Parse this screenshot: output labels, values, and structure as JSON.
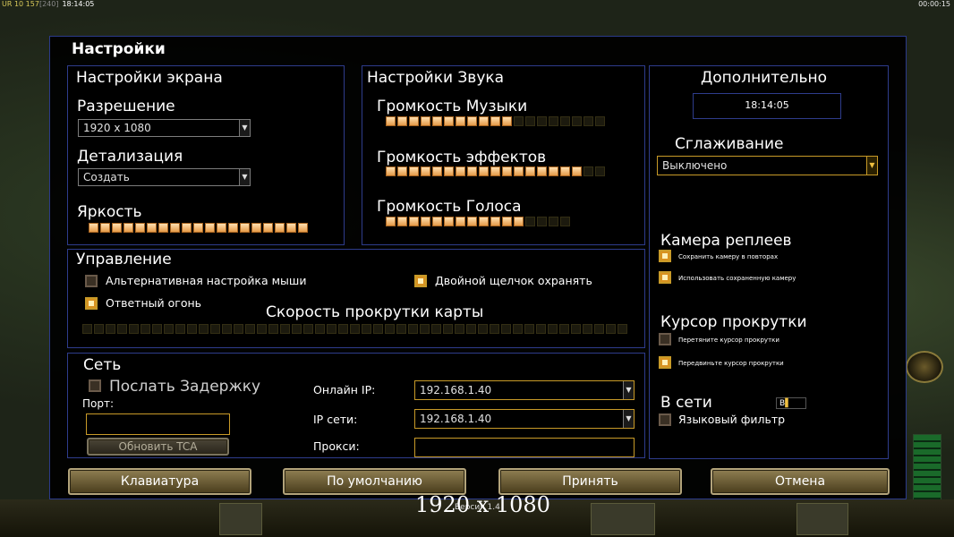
{
  "hud": {
    "resource_prefix": "UR 10 157",
    "resource_dim": "[240]",
    "clock_left": "18:14:05",
    "clock_right": "00:00:15"
  },
  "dialog": {
    "title": "Настройки"
  },
  "screen": {
    "title": "Настройки экрана",
    "resolution_label": "Разрешение",
    "resolution_value": "1920 x 1080",
    "detail_label": "Детализация",
    "detail_value": "Создать",
    "brightness_label": "Яркость",
    "brightness_level": 1.0
  },
  "sound": {
    "title": "Настройки Звука",
    "music_label": "Громкость Музыки",
    "music_level": 0.58,
    "effects_label": "Громкость эффектов",
    "effects_level": 0.87,
    "voice_label": "Громкость Голоса",
    "voice_level": 0.75
  },
  "extra": {
    "title": "Дополнительно",
    "clock": "18:14:05",
    "antialias_label": "Сглаживание",
    "antialias_value": "Выключено",
    "replay_camera_title": "Камера реплеев",
    "replay_save_camera": "Сохранить камеру в повторах",
    "replay_use_saved_camera": "Использовать сохраненную камеру",
    "scroll_cursor_title": "Курсор прокрутки",
    "scroll_cursor_opt1": "Перетяните курсор прокрутки",
    "scroll_cursor_opt2": "Передвиньте курсор прокрутки",
    "online_title": "В сети",
    "lang_badge": "В",
    "lang_filter_label": "Языковый фильтр"
  },
  "controls": {
    "title": "Управление",
    "alt_mouse_label": "Альтернативная настройка мыши",
    "double_click_label": "Двойной щелчок охранять",
    "return_fire_label": "Ответный огонь",
    "scroll_speed_label": "Скорость прокрутки карты",
    "scroll_speed_level": 0.0
  },
  "network": {
    "title": "Сеть",
    "send_delay_label": "Послать Задержку",
    "port_label": "Порт:",
    "update_tca_label": "Обновить TCA",
    "online_ip_label": "Онлайн IP:",
    "online_ip_value": "192.168.1.40",
    "lan_ip_label": "IP сети:",
    "lan_ip_value": "192.168.1.40",
    "proxy_label": "Прокси:"
  },
  "buttons": {
    "keyboard": "Клавиатура",
    "defaults": "По умолчанию",
    "accept": "Принять",
    "cancel": "Отмена"
  },
  "overlay": {
    "resolution_text": "1920 x 1080",
    "version_text": "Версия 1.4"
  },
  "colors": {
    "panel_border": "#2e3c8c",
    "accent_gold": "#c89a28",
    "slider_on": "#e49a48"
  }
}
